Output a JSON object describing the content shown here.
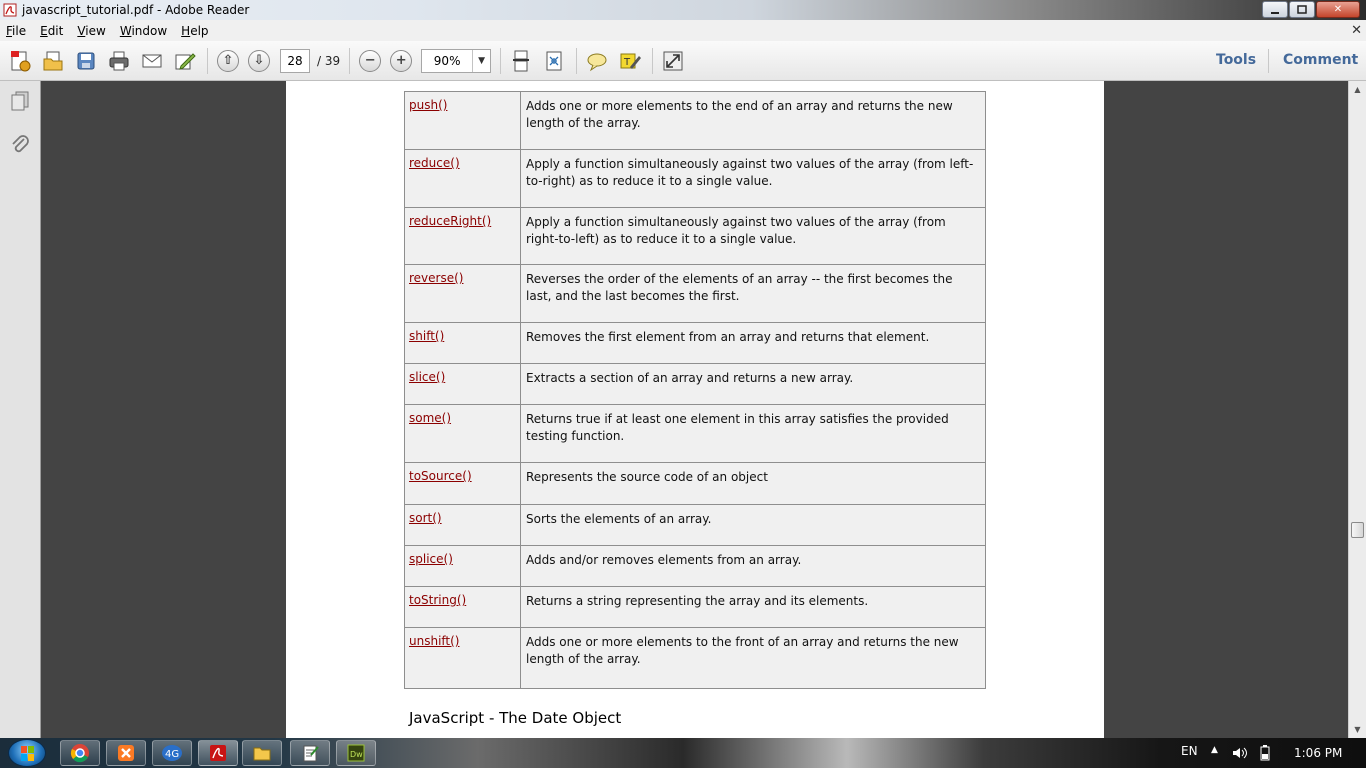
{
  "window": {
    "title": "javascript_tutorial.pdf - Adobe Reader"
  },
  "menu": {
    "items": [
      "File",
      "Edit",
      "View",
      "Window",
      "Help"
    ]
  },
  "toolbar": {
    "current_page": "28",
    "total_pages": "/ 39",
    "zoom": "90%",
    "tools_label": "Tools",
    "comment_label": "Comment"
  },
  "document": {
    "methods": [
      {
        "name": "push()",
        "description": "Adds one or more elements to the end of an array and returns the new length of the array."
      },
      {
        "name": "reduce()",
        "description": "Apply a function simultaneously against two values of the array (from left-to-right) as to reduce it to a single value."
      },
      {
        "name": "reduceRight()",
        "description": "Apply a function simultaneously against two values of the array (from right-to-left) as to reduce it to a single value."
      },
      {
        "name": "reverse()",
        "description": "Reverses the order of the elements of an array -- the first becomes the last, and the last becomes the first."
      },
      {
        "name": "shift()",
        "description": "Removes the first element from an array and returns that element."
      },
      {
        "name": "slice()",
        "description": "Extracts a section of an array and returns a new array."
      },
      {
        "name": "some()",
        "description": "Returns true if at least one element in this array satisfies the provided testing function."
      },
      {
        "name": "toSource()",
        "description": "Represents the source code of an object"
      },
      {
        "name": "sort()",
        "description": "Sorts the elements of an array."
      },
      {
        "name": "splice()",
        "description": "Adds and/or removes elements from an array."
      },
      {
        "name": "toString()",
        "description": "Returns a string representing the array and its elements."
      },
      {
        "name": "unshift()",
        "description": "Adds one or more elements to the front of an array and returns the new length of the array."
      }
    ],
    "next_heading": "JavaScript - The Date Object"
  },
  "taskbar": {
    "language": "EN",
    "time": "1:06 PM"
  },
  "colors": {
    "link": "#8b0000",
    "accent_blue": "#44699a",
    "doc_background": "#444444"
  }
}
